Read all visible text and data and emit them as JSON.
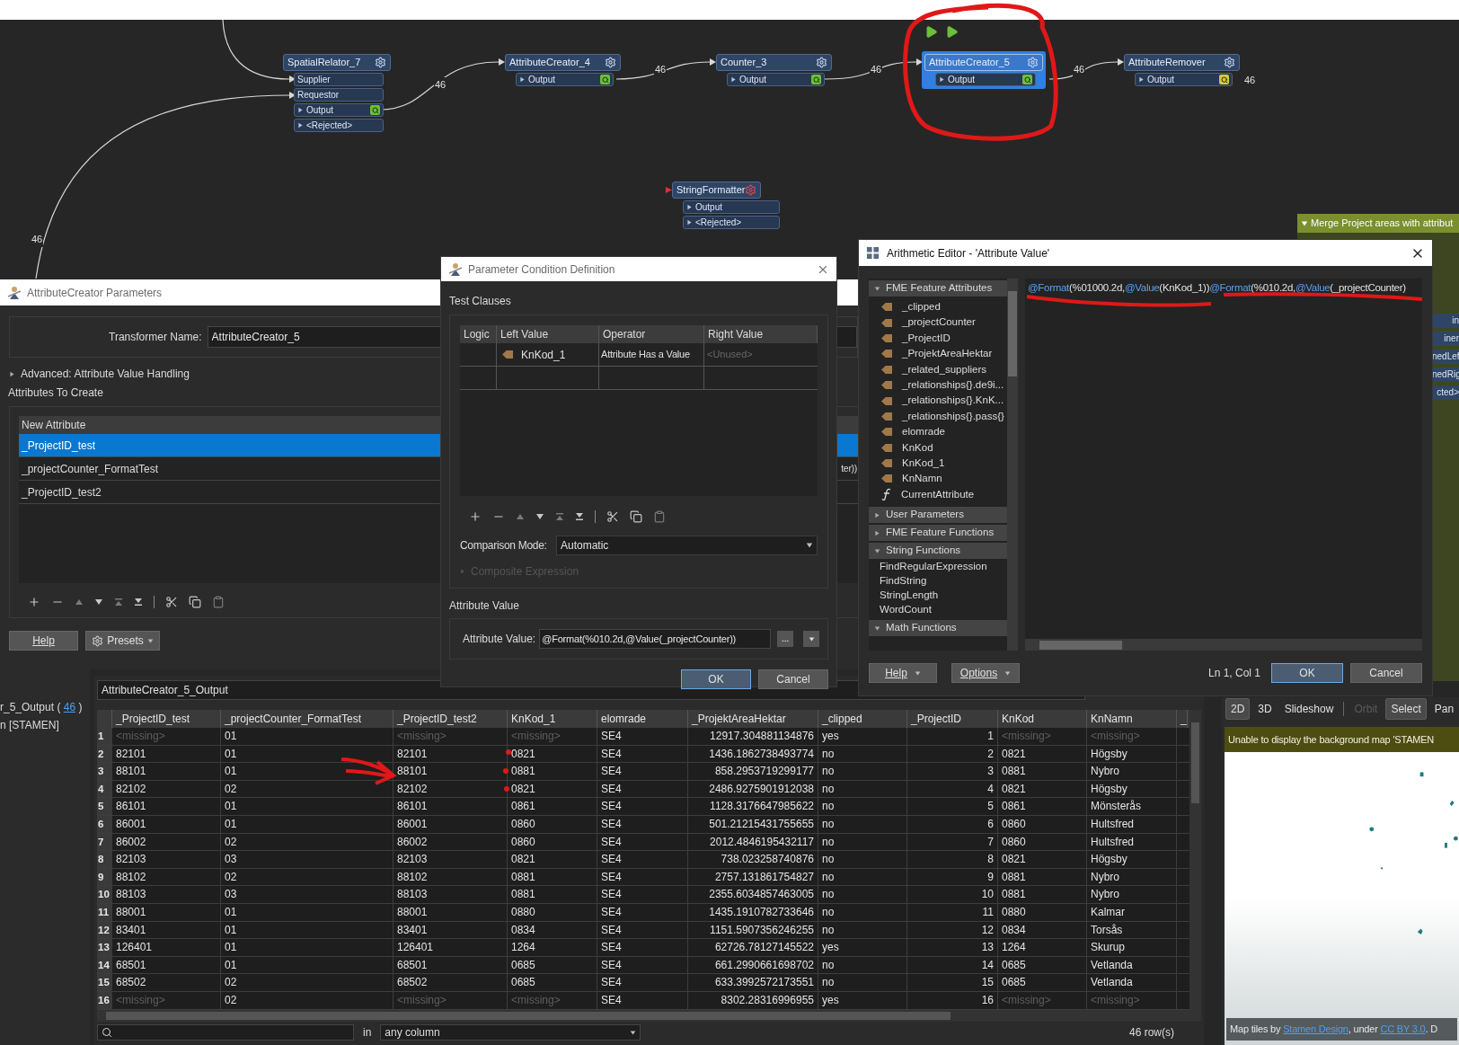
{
  "canvas": {
    "nodes": [
      {
        "name": "SpatialRelator_7",
        "selected": false,
        "warning": false,
        "ports": [
          {
            "label": "Supplier",
            "kind": "input"
          },
          {
            "label": "Requestor",
            "kind": "input"
          },
          {
            "label": "Output",
            "kind": "output",
            "color": "#6cbf3a"
          },
          {
            "label": "<Rejected>",
            "kind": "output"
          }
        ]
      },
      {
        "name": "AttributeCreator_4",
        "selected": false,
        "warning": false,
        "ports": [
          {
            "label": "Output",
            "kind": "output",
            "color": "#6cbf3a"
          }
        ]
      },
      {
        "name": "Counter_3",
        "selected": false,
        "warning": false,
        "ports": [
          {
            "label": "Output",
            "kind": "output",
            "color": "#6cbf3a"
          }
        ]
      },
      {
        "name": "AttributeCreator_5",
        "selected": true,
        "warning": false,
        "ports": [
          {
            "label": "Output",
            "kind": "output",
            "color": "#6cbf3a"
          }
        ]
      },
      {
        "name": "AttributeRemover",
        "selected": false,
        "warning": false,
        "ports": [
          {
            "label": "Output",
            "kind": "output",
            "color": "#d8c93a"
          }
        ]
      },
      {
        "name": "StringFormatter",
        "selected": false,
        "warning": true,
        "ports": [
          {
            "label": "Output",
            "kind": "output"
          },
          {
            "label": "<Rejected>",
            "kind": "output"
          }
        ]
      }
    ],
    "counts": [
      "46",
      "46",
      "46",
      "46",
      "46",
      "46"
    ],
    "bookmark": {
      "title": "Merge Project areas with attribut",
      "fragments": [
        "in",
        "iner",
        "nedLef",
        "nedRig",
        "cted>"
      ]
    }
  },
  "attribute_creator": {
    "title": "AttributeCreator Parameters",
    "name_label": "Transformer Name:",
    "name_value": "AttributeCreator_5",
    "advanced": {
      "label": "Advanced: Attribute Value Handling",
      "expanded": false
    },
    "section": "Attributes To Create",
    "column": "New Attribute",
    "rows": [
      {
        "text": "_ProjectID_test",
        "selected": true
      },
      {
        "text": "_projectCounter_FormatTest",
        "selected": false,
        "value": "ter))"
      },
      {
        "text": "_ProjectID_test2",
        "selected": false
      }
    ],
    "buttons": [
      "Help",
      "Presets"
    ]
  },
  "condition_dialog": {
    "title": "Parameter Condition Definition",
    "section": "Test Clauses",
    "columns": [
      "Logic",
      "Left Value",
      "Operator",
      "Right Value"
    ],
    "clauses": [
      {
        "left": "KnKod_1",
        "operator": "Attribute Has a Value",
        "right_hint": "<Unused>"
      }
    ],
    "comparison": {
      "label": "Comparison Mode:",
      "value": "Automatic"
    },
    "composite": {
      "label": "Composite Expression",
      "disabled": true
    },
    "value_section": "Attribute Value",
    "value_label": "Attribute Value:",
    "value": "@Format(%010.2d,@Value(_projectCounter))",
    "more": "...",
    "buttons": [
      {
        "label": "OK",
        "default": true
      },
      {
        "label": "Cancel",
        "default": false
      }
    ]
  },
  "arithmetic_editor": {
    "title": "Arithmetic Editor - 'Attribute Value'",
    "groups": [
      {
        "label": "FME Feature Attributes",
        "expanded": true,
        "items": [
          {
            "label": "_clipped",
            "kind": "attribute"
          },
          {
            "label": "_projectCounter",
            "kind": "attribute"
          },
          {
            "label": "_ProjectID",
            "kind": "attribute"
          },
          {
            "label": "_ProjektAreaHektar",
            "kind": "attribute"
          },
          {
            "label": "_related_suppliers",
            "kind": "attribute"
          },
          {
            "label": "_relationships{}.de9i...",
            "kind": "attribute"
          },
          {
            "label": "_relationships{}.KnK...",
            "kind": "attribute"
          },
          {
            "label": "_relationships{}.pass{}",
            "kind": "attribute"
          },
          {
            "label": "elomrade",
            "kind": "attribute"
          },
          {
            "label": "KnKod",
            "kind": "attribute"
          },
          {
            "label": "KnKod_1",
            "kind": "attribute"
          },
          {
            "label": "KnNamn",
            "kind": "attribute"
          },
          {
            "label": "CurrentAttribute",
            "kind": "function"
          }
        ]
      },
      {
        "label": "User Parameters",
        "expanded": false
      },
      {
        "label": "FME Feature Functions",
        "expanded": false
      },
      {
        "label": "String Functions",
        "expanded": true,
        "items": [
          {
            "label": "FindRegularExpression",
            "kind": "plain"
          },
          {
            "label": "FindString",
            "kind": "plain"
          },
          {
            "label": "StringLength",
            "kind": "plain"
          },
          {
            "label": "WordCount",
            "kind": "plain"
          }
        ]
      },
      {
        "label": "Math Functions",
        "expanded": true
      }
    ],
    "expression": [
      {
        "text": "@Format",
        "kind": "function"
      },
      {
        "text": "(%01000.2d,",
        "kind": "plain"
      },
      {
        "text": "@Value",
        "kind": "function"
      },
      {
        "text": "(KnKod_1))",
        "kind": "plain"
      },
      {
        "text": "@Format",
        "kind": "function"
      },
      {
        "text": "(%010.2d,",
        "kind": "plain"
      },
      {
        "text": "@Value",
        "kind": "function"
      },
      {
        "text": "(_projectCounter)",
        "kind": "plain"
      }
    ],
    "buttons": [
      "Help",
      "Options"
    ],
    "position": "Ln 1, Col 1",
    "actions": [
      {
        "label": "OK",
        "default": true
      },
      {
        "label": "Cancel",
        "default": false
      }
    ]
  },
  "left_panel": {
    "lines": [
      [
        {
          "text": "r_5_Output ( ",
          "kind": "plain"
        },
        {
          "text": "46",
          "kind": "link"
        },
        {
          "text": " )",
          "kind": "plain"
        }
      ],
      [
        {
          "text": "n [STAMEN]",
          "kind": "plain"
        }
      ]
    ]
  },
  "output_table": {
    "name": "AttributeCreator_5_Output",
    "columns": [
      {
        "label": "_ProjectID_test",
        "numeric": false
      },
      {
        "label": "_projectCounter_FormatTest",
        "numeric": false
      },
      {
        "label": "_ProjectID_test2",
        "numeric": false
      },
      {
        "label": "KnKod_1",
        "numeric": false
      },
      {
        "label": "elomrade",
        "numeric": false
      },
      {
        "label": "_ProjektAreaHektar",
        "numeric": true
      },
      {
        "label": "_clipped",
        "numeric": false
      },
      {
        "label": "_ProjectID",
        "numeric": true
      },
      {
        "label": "KnKod",
        "numeric": false
      },
      {
        "label": "KnNamn",
        "numeric": false
      },
      {
        "label": "_"
      }
    ],
    "rows": [
      {
        "number": "1",
        "cells": [
          {
            "text": "<missing>",
            "missing": true
          },
          "01",
          {
            "text": "<missing>",
            "missing": true
          },
          {
            "text": "<missing>",
            "missing": true
          },
          "SE4",
          "12917.304881134876",
          "yes",
          "1",
          {
            "text": "<missing>",
            "missing": true
          },
          {
            "text": "<missing>",
            "missing": true
          }
        ]
      },
      {
        "number": "2",
        "cells": [
          "82101",
          "01",
          "82101",
          "0821",
          "SE4",
          "1436.1862738493774",
          "no",
          "2",
          "0821",
          "Högsby"
        ]
      },
      {
        "number": "3",
        "cells": [
          "88101",
          "01",
          "88101",
          "0881",
          "SE4",
          "858.2953719299177",
          "no",
          "3",
          "0881",
          "Nybro"
        ]
      },
      {
        "number": "4",
        "cells": [
          "82102",
          "02",
          "82102",
          "0821",
          "SE4",
          "2486.9275901912038",
          "no",
          "4",
          "0821",
          "Högsby"
        ]
      },
      {
        "number": "5",
        "cells": [
          "86101",
          "01",
          "86101",
          "0861",
          "SE4",
          "1128.3176647985622",
          "no",
          "5",
          "0861",
          "Mönsterås"
        ]
      },
      {
        "number": "6",
        "cells": [
          "86001",
          "01",
          "86001",
          "0860",
          "SE4",
          "501.21215431755655",
          "no",
          "6",
          "0860",
          "Hultsfred"
        ]
      },
      {
        "number": "7",
        "cells": [
          "86002",
          "02",
          "86002",
          "0860",
          "SE4",
          "2012.4846195432117",
          "no",
          "7",
          "0860",
          "Hultsfred"
        ]
      },
      {
        "number": "8",
        "cells": [
          "82103",
          "03",
          "82103",
          "0821",
          "SE4",
          "738.023258740876",
          "no",
          "8",
          "0821",
          "Högsby"
        ]
      },
      {
        "number": "9",
        "cells": [
          "88102",
          "02",
          "88102",
          "0881",
          "SE4",
          "2757.131861754827",
          "no",
          "9",
          "0881",
          "Nybro"
        ]
      },
      {
        "number": "10",
        "cells": [
          "88103",
          "03",
          "88103",
          "0881",
          "SE4",
          "2355.6034857463005",
          "no",
          "10",
          "0881",
          "Nybro"
        ]
      },
      {
        "number": "11",
        "cells": [
          "88001",
          "01",
          "88001",
          "0880",
          "SE4",
          "1435.1910782733646",
          "no",
          "11",
          "0880",
          "Kalmar"
        ]
      },
      {
        "number": "12",
        "cells": [
          "83401",
          "01",
          "83401",
          "0834",
          "SE4",
          "1151.5907356246255",
          "no",
          "12",
          "0834",
          "Torsås"
        ]
      },
      {
        "number": "13",
        "cells": [
          "126401",
          "01",
          "126401",
          "1264",
          "SE4",
          "62726.78127145522",
          "yes",
          "13",
          "1264",
          "Skurup"
        ]
      },
      {
        "number": "14",
        "cells": [
          "68501",
          "01",
          "68501",
          "0685",
          "SE4",
          "661.2990661698702",
          "no",
          "14",
          "0685",
          "Vetlanda"
        ]
      },
      {
        "number": "15",
        "cells": [
          "68502",
          "02",
          "68502",
          "0685",
          "SE4",
          "633.3992572173551",
          "no",
          "15",
          "0685",
          "Vetlanda"
        ]
      },
      {
        "number": "16",
        "cells": [
          {
            "text": "<missing>",
            "missing": true
          },
          "02",
          {
            "text": "<missing>",
            "missing": true
          },
          {
            "text": "<missing>",
            "missing": true
          },
          "SE4",
          "8302.28316996955",
          "yes",
          "16",
          {
            "text": "<missing>",
            "missing": true
          },
          {
            "text": "<missing>",
            "missing": true
          }
        ]
      }
    ],
    "search": {
      "in_label": "in",
      "scope": "any column",
      "row_count": "46 row(s)"
    }
  },
  "map_view": {
    "modes": [
      {
        "label": "2D",
        "selected": true
      },
      {
        "label": "3D",
        "selected": false
      },
      {
        "label": "Slideshow",
        "selected": false
      }
    ],
    "tools": [
      {
        "label": "Orbit",
        "selected": false,
        "disabled": true
      },
      {
        "label": "Select",
        "selected": true,
        "disabled": false
      },
      {
        "label": "Pan",
        "selected": false,
        "disabled": false
      }
    ],
    "banner": "Unable to display the background map 'STAMEN",
    "attribution": [
      {
        "text": "Map tiles by ",
        "kind": "plain"
      },
      {
        "text": "Stamen Design",
        "kind": "link"
      },
      {
        "text": ", under ",
        "kind": "plain"
      },
      {
        "text": "CC BY 3.0",
        "kind": "link"
      },
      {
        "text": ". D",
        "kind": "plain"
      }
    ]
  }
}
